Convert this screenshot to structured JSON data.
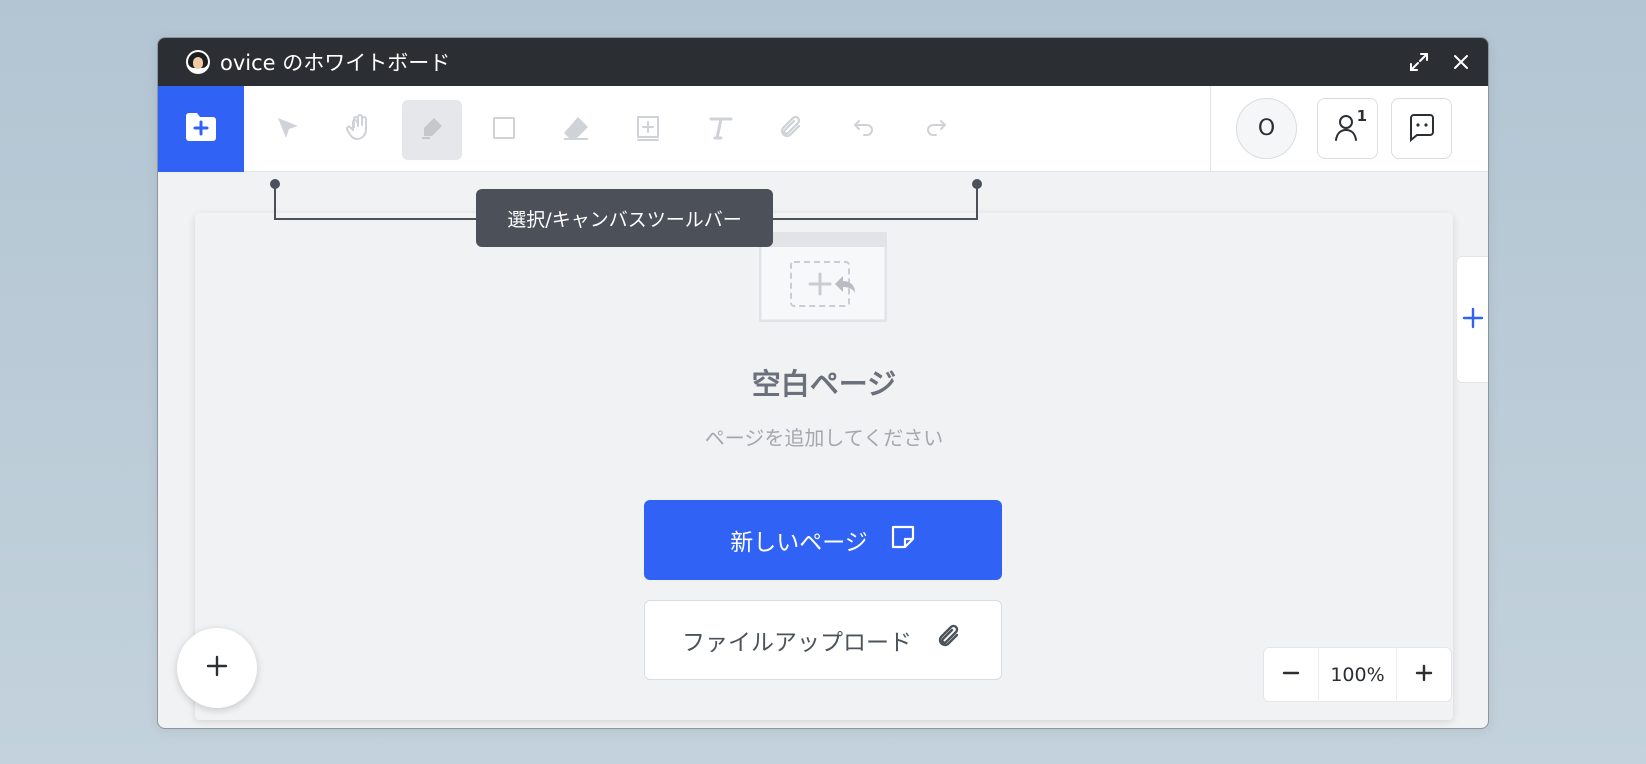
{
  "window": {
    "title": "ovice のホワイトボード",
    "icons": {
      "avatar": "user-avatar-icon",
      "expand": "expand-icon",
      "close": "close-icon"
    }
  },
  "toolbar": {
    "folder_icon": "folder-add-icon",
    "tools": [
      {
        "name": "select",
        "icon": "cursor-arrow-icon",
        "active": false
      },
      {
        "name": "hand",
        "icon": "hand-icon",
        "active": false
      },
      {
        "name": "pen",
        "icon": "pen-icon",
        "active": true
      },
      {
        "name": "rectangle",
        "icon": "rectangle-icon",
        "active": false
      },
      {
        "name": "eraser",
        "icon": "eraser-icon",
        "active": false
      },
      {
        "name": "sticky",
        "icon": "add-note-icon",
        "active": false
      },
      {
        "name": "text",
        "icon": "text-icon",
        "active": false
      },
      {
        "name": "attach",
        "icon": "paperclip-icon",
        "active": false
      },
      {
        "name": "undo",
        "icon": "undo-icon",
        "active": false
      },
      {
        "name": "redo",
        "icon": "redo-icon",
        "active": false
      }
    ],
    "user_initial": "O",
    "participants_count": "1",
    "participants_icon": "user-icon",
    "chat_icon": "chat-icon"
  },
  "tooltip": {
    "label": "選択/キャンバスツールバー"
  },
  "canvas": {
    "empty_title": "空白ページ",
    "empty_subtitle": "ページを追加してください",
    "new_page_label": "新しいページ",
    "new_page_icon": "sticky-note-icon",
    "upload_label": "ファイルアップロード",
    "upload_icon": "paperclip-icon"
  },
  "zoom": {
    "value": "100%"
  },
  "colors": {
    "accent": "#2f62f5",
    "titlebar": "#2b2f33",
    "tooltip_bg": "#4b5059"
  }
}
